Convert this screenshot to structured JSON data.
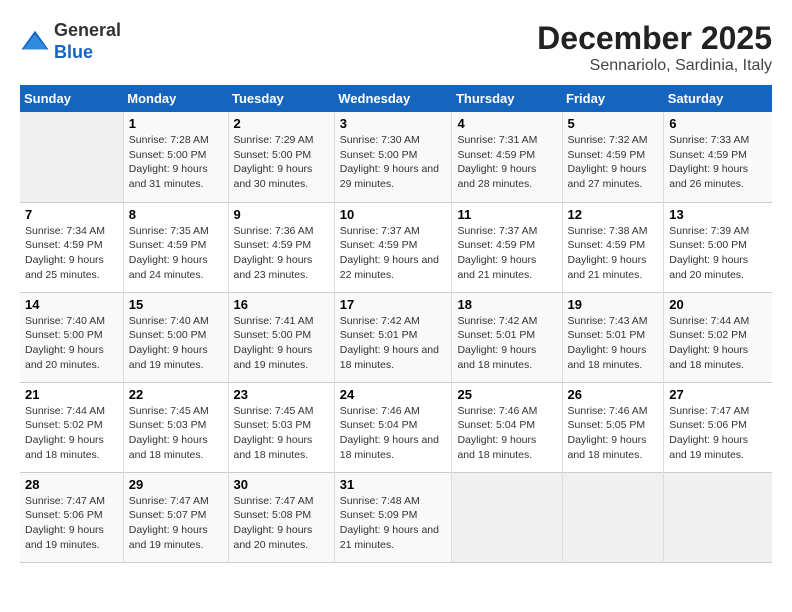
{
  "header": {
    "logo_line1": "General",
    "logo_line2": "Blue",
    "month": "December 2025",
    "location": "Sennariolo, Sardinia, Italy"
  },
  "weekdays": [
    "Sunday",
    "Monday",
    "Tuesday",
    "Wednesday",
    "Thursday",
    "Friday",
    "Saturday"
  ],
  "weeks": [
    [
      {
        "day": "",
        "empty": true
      },
      {
        "day": "1",
        "sunrise": "7:28 AM",
        "sunset": "5:00 PM",
        "daylight": "9 hours and 31 minutes."
      },
      {
        "day": "2",
        "sunrise": "7:29 AM",
        "sunset": "5:00 PM",
        "daylight": "9 hours and 30 minutes."
      },
      {
        "day": "3",
        "sunrise": "7:30 AM",
        "sunset": "5:00 PM",
        "daylight": "9 hours and 29 minutes."
      },
      {
        "day": "4",
        "sunrise": "7:31 AM",
        "sunset": "4:59 PM",
        "daylight": "9 hours and 28 minutes."
      },
      {
        "day": "5",
        "sunrise": "7:32 AM",
        "sunset": "4:59 PM",
        "daylight": "9 hours and 27 minutes."
      },
      {
        "day": "6",
        "sunrise": "7:33 AM",
        "sunset": "4:59 PM",
        "daylight": "9 hours and 26 minutes."
      }
    ],
    [
      {
        "day": "7",
        "sunrise": "7:34 AM",
        "sunset": "4:59 PM",
        "daylight": "9 hours and 25 minutes."
      },
      {
        "day": "8",
        "sunrise": "7:35 AM",
        "sunset": "4:59 PM",
        "daylight": "9 hours and 24 minutes."
      },
      {
        "day": "9",
        "sunrise": "7:36 AM",
        "sunset": "4:59 PM",
        "daylight": "9 hours and 23 minutes."
      },
      {
        "day": "10",
        "sunrise": "7:37 AM",
        "sunset": "4:59 PM",
        "daylight": "9 hours and 22 minutes."
      },
      {
        "day": "11",
        "sunrise": "7:37 AM",
        "sunset": "4:59 PM",
        "daylight": "9 hours and 21 minutes."
      },
      {
        "day": "12",
        "sunrise": "7:38 AM",
        "sunset": "4:59 PM",
        "daylight": "9 hours and 21 minutes."
      },
      {
        "day": "13",
        "sunrise": "7:39 AM",
        "sunset": "5:00 PM",
        "daylight": "9 hours and 20 minutes."
      }
    ],
    [
      {
        "day": "14",
        "sunrise": "7:40 AM",
        "sunset": "5:00 PM",
        "daylight": "9 hours and 20 minutes."
      },
      {
        "day": "15",
        "sunrise": "7:40 AM",
        "sunset": "5:00 PM",
        "daylight": "9 hours and 19 minutes."
      },
      {
        "day": "16",
        "sunrise": "7:41 AM",
        "sunset": "5:00 PM",
        "daylight": "9 hours and 19 minutes."
      },
      {
        "day": "17",
        "sunrise": "7:42 AM",
        "sunset": "5:01 PM",
        "daylight": "9 hours and 18 minutes."
      },
      {
        "day": "18",
        "sunrise": "7:42 AM",
        "sunset": "5:01 PM",
        "daylight": "9 hours and 18 minutes."
      },
      {
        "day": "19",
        "sunrise": "7:43 AM",
        "sunset": "5:01 PM",
        "daylight": "9 hours and 18 minutes."
      },
      {
        "day": "20",
        "sunrise": "7:44 AM",
        "sunset": "5:02 PM",
        "daylight": "9 hours and 18 minutes."
      }
    ],
    [
      {
        "day": "21",
        "sunrise": "7:44 AM",
        "sunset": "5:02 PM",
        "daylight": "9 hours and 18 minutes."
      },
      {
        "day": "22",
        "sunrise": "7:45 AM",
        "sunset": "5:03 PM",
        "daylight": "9 hours and 18 minutes."
      },
      {
        "day": "23",
        "sunrise": "7:45 AM",
        "sunset": "5:03 PM",
        "daylight": "9 hours and 18 minutes."
      },
      {
        "day": "24",
        "sunrise": "7:46 AM",
        "sunset": "5:04 PM",
        "daylight": "9 hours and 18 minutes."
      },
      {
        "day": "25",
        "sunrise": "7:46 AM",
        "sunset": "5:04 PM",
        "daylight": "9 hours and 18 minutes."
      },
      {
        "day": "26",
        "sunrise": "7:46 AM",
        "sunset": "5:05 PM",
        "daylight": "9 hours and 18 minutes."
      },
      {
        "day": "27",
        "sunrise": "7:47 AM",
        "sunset": "5:06 PM",
        "daylight": "9 hours and 19 minutes."
      }
    ],
    [
      {
        "day": "28",
        "sunrise": "7:47 AM",
        "sunset": "5:06 PM",
        "daylight": "9 hours and 19 minutes."
      },
      {
        "day": "29",
        "sunrise": "7:47 AM",
        "sunset": "5:07 PM",
        "daylight": "9 hours and 19 minutes."
      },
      {
        "day": "30",
        "sunrise": "7:47 AM",
        "sunset": "5:08 PM",
        "daylight": "9 hours and 20 minutes."
      },
      {
        "day": "31",
        "sunrise": "7:48 AM",
        "sunset": "5:09 PM",
        "daylight": "9 hours and 21 minutes."
      },
      {
        "day": "",
        "empty": true
      },
      {
        "day": "",
        "empty": true
      },
      {
        "day": "",
        "empty": true
      }
    ]
  ],
  "labels": {
    "sunrise": "Sunrise:",
    "sunset": "Sunset:",
    "daylight": "Daylight:"
  }
}
